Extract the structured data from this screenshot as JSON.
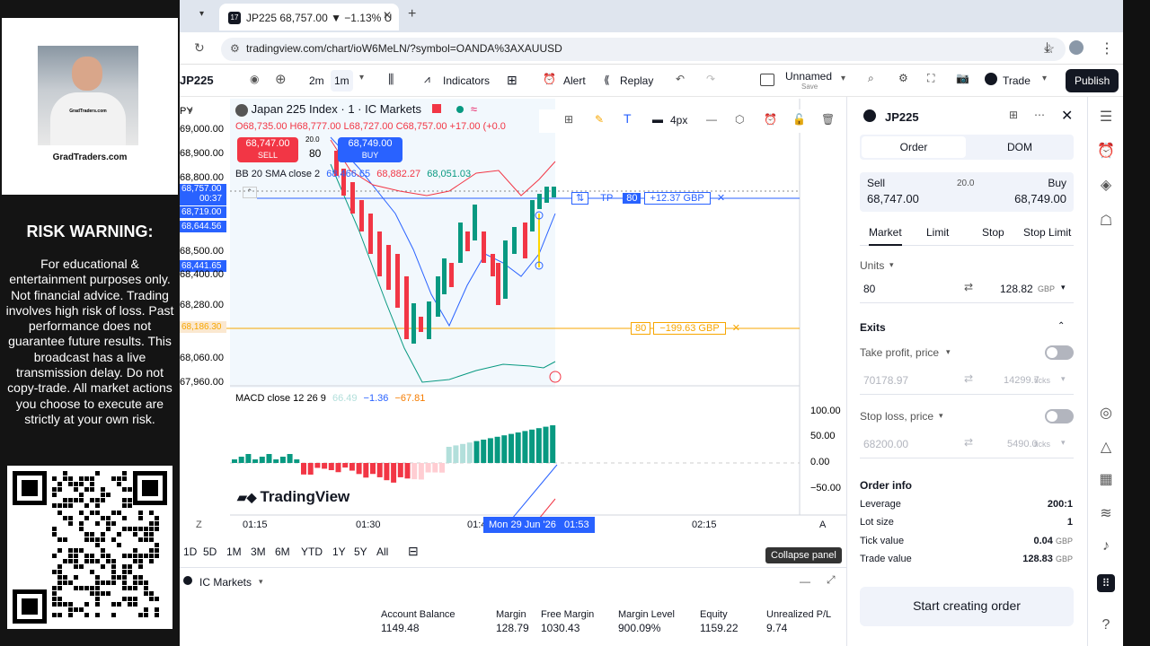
{
  "overlay": {
    "brand": "GradTraders.com",
    "shirt_text": "GradTraders.com",
    "risk_title": "RISK WARNING:",
    "risk_text": "For educational & entertainment purposes only. Not financial advice. Trading involves high risk of loss. Past performance does not guarantee future results. This broadcast has a live transmission delay. Do not copy-trade. All market actions you choose to execute are strictly at your own risk."
  },
  "browser": {
    "tab_title": "JP225 68,757.00 ▼ −1.13% U",
    "url": "tradingview.com/chart/ioW6MeLN/?symbol=OANDA%3AXAUUSD"
  },
  "toolbar": {
    "symbol": "JP225",
    "interval_2m": "2m",
    "interval_1m": "1m",
    "indicators": "Indicators",
    "alert": "Alert",
    "replay": "Replay",
    "layout_name": "Unnamed",
    "layout_sub": "Save",
    "trade": "Trade",
    "publish": "Publish"
  },
  "chart": {
    "title": "Japan 225 Index · 1 · IC Markets",
    "ohlc": "O68,735.00 H68,777.00 L68,727.00 C68,757.00 +17.00 (+0.0",
    "sell_price": "68,747.00",
    "sell_label": "SELL",
    "spread": "20.0",
    "qty": "80",
    "buy_price": "68,749.00",
    "buy_label": "BUY",
    "bb_label": "BB 20 SMA close 2",
    "bb_v1": "68,466.65",
    "bb_v2": "68,882.27",
    "bb_v3": "68,051.03",
    "brush_size": "4px",
    "tp_label": "TP",
    "tp_qty": "80",
    "tp_pnl": "+12.37 GBP",
    "sl_qty": "80",
    "sl_pnl": "−199.63 GBP",
    "macd_label": "MACD close 12 26 9",
    "macd_v1": "66.49",
    "macd_v2": "−1.36",
    "macd_v3": "−67.81",
    "prices": [
      "69,000.00",
      "68,800.00",
      "68,757.00",
      "00:37",
      "68,719.00",
      "68,644.56",
      "68,500.00",
      "68,441.65",
      "68,400.00",
      "68,280.00",
      "68,186.30",
      "68,060.00",
      "67,960.00"
    ],
    "price_top": "68,900.00",
    "macd_axis": [
      "100.00",
      "50.00",
      "0.00",
      "−50.00"
    ],
    "times": [
      "01:15",
      "01:30",
      "01:45",
      "02:15"
    ],
    "time_cursor": "Mon 29 Jun '26",
    "time_cursor_t": "01:53",
    "watermark": "TradingView",
    "ranges": [
      "1D",
      "5D",
      "1M",
      "3M",
      "6M",
      "YTD",
      "1Y",
      "5Y",
      "All"
    ],
    "tooltip": "Collapse panel",
    "left_axis_symbol": "PY",
    "z_label": "Z",
    "a_label": "A"
  },
  "bottom": {
    "broker": "IC Markets",
    "headers": [
      "Account Balance",
      "Margin",
      "Free Margin",
      "Margin Level",
      "Equity",
      "Unrealized P/L"
    ],
    "values": [
      "1149.48",
      "128.79",
      "1030.43",
      "900.09%",
      "1159.22",
      "9.74"
    ]
  },
  "order": {
    "symbol": "JP225",
    "tab_order": "Order",
    "tab_dom": "DOM",
    "sell_label": "Sell",
    "sell_price": "68,747.00",
    "spread": "20.0",
    "buy_label": "Buy",
    "buy_price": "68,749.00",
    "types": [
      "Market",
      "Limit",
      "Stop",
      "Stop Limit"
    ],
    "units_label": "Units",
    "units": "80",
    "units_value": "128.82",
    "currency": "GBP",
    "exits": "Exits",
    "tp_label": "Take profit, price",
    "tp_price": "70178.97",
    "tp_ticks": "14299.7",
    "sl_label": "Stop loss, price",
    "sl_price": "68200.00",
    "sl_ticks": "5490.0",
    "ticks": "ticks",
    "info": "Order info",
    "leverage_l": "Leverage",
    "leverage": "200:1",
    "lot_l": "Lot size",
    "lot": "1",
    "tick_l": "Tick value",
    "tick": "0.04",
    "trade_l": "Trade value",
    "trade": "128.83",
    "start": "Start creating order"
  }
}
